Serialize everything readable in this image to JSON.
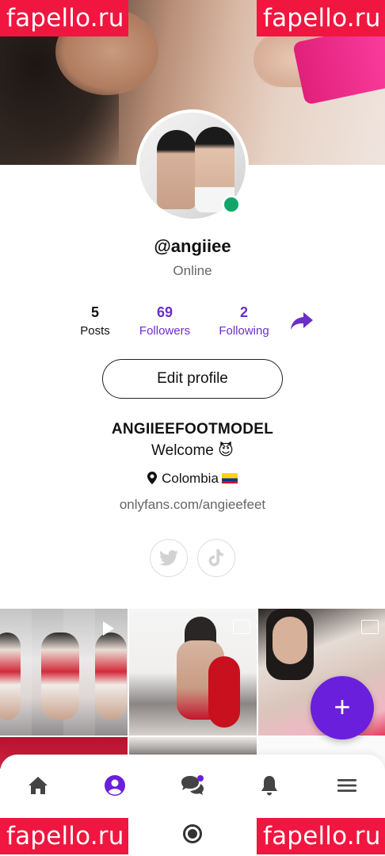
{
  "watermark": {
    "text": "fapello.ru",
    "color": "#f0163f"
  },
  "profile": {
    "username": "@angiiee",
    "status": "Online",
    "display_name": "ANGIIEEFOOTMODEL",
    "bio": "Welcome 😈",
    "location": "Colombia",
    "link": "onlyfans.com/angieefeet",
    "online_color": "#11a56a"
  },
  "stats": {
    "posts": {
      "value": "5",
      "label": "Posts"
    },
    "followers": {
      "value": "69",
      "label": "Followers"
    },
    "following": {
      "value": "2",
      "label": "Following"
    }
  },
  "actions": {
    "edit_profile": "Edit profile",
    "add": "+"
  },
  "social": [
    "twitter-icon",
    "tiktok-icon"
  ],
  "nav": [
    "home-icon",
    "profile-icon",
    "messages-icon",
    "notifications-icon",
    "menu-icon"
  ],
  "accent_color": "#6a1fdc",
  "link_color": "#6a2fc7"
}
